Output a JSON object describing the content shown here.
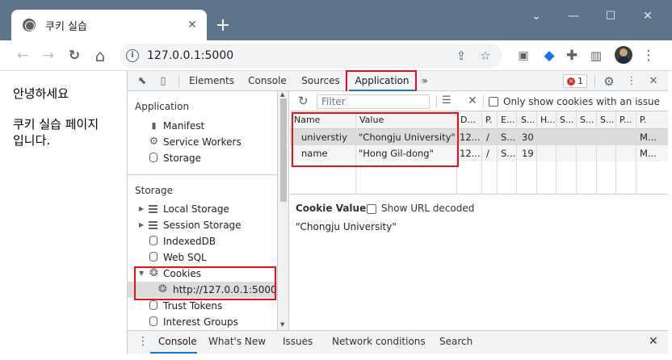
{
  "window": {
    "tab_title": "쿠키 실습",
    "tab_close": "✕",
    "new_tab": "+",
    "minimize": "—",
    "maximize": "☐",
    "close": "✕"
  },
  "toolbar": {
    "url": "127.0.0.1:5000",
    "back": "←",
    "forward": "→",
    "reload": "↻",
    "home": "⌂",
    "info": "i"
  },
  "page": {
    "line1": "안녕하세요",
    "line2": "쿠키 실습 페이지",
    "line3": "입니다."
  },
  "devtools": {
    "tabs": [
      "Elements",
      "Console",
      "Sources",
      "Application"
    ],
    "more_tabs": "»",
    "error_count": "1",
    "sidebar": {
      "application_header": "Application",
      "application_items": [
        "Manifest",
        "Service Workers",
        "Storage"
      ],
      "storage_header": "Storage",
      "storage_items": [
        "Local Storage",
        "Session Storage",
        "IndexedDB",
        "Web SQL",
        "Cookies"
      ],
      "cookie_origin": "http://127.0.0.1:5000",
      "other_items": [
        "Trust Tokens",
        "Interest Groups"
      ]
    },
    "filter": {
      "placeholder": "Filter",
      "only_issue_label": "Only show cookies with an issue"
    },
    "cookie_table": {
      "columns": [
        "Name",
        "Value",
        "D...",
        "P.",
        "E...",
        "S...",
        "H...",
        "S...",
        "S...",
        "S...",
        "P...",
        "P."
      ],
      "rows": [
        [
          "universtiy",
          "\"Chongju University\"",
          "12...",
          "/",
          "S...",
          "30",
          "",
          "",
          "",
          "",
          "",
          "M..."
        ],
        [
          "name",
          "\"Hong Gil-dong\"",
          "12...",
          "/",
          "S...",
          "19",
          "",
          "",
          "",
          "",
          "",
          "M..."
        ]
      ]
    },
    "cookie_value": {
      "header": "Cookie Value",
      "show_decoded_label": "Show URL decoded",
      "value": "\"Chongju University\""
    },
    "drawer": {
      "tabs": [
        "Console",
        "What's New",
        "Issues",
        "Network conditions",
        "Search"
      ],
      "close": "✕"
    }
  }
}
